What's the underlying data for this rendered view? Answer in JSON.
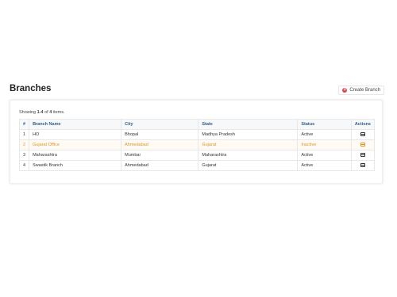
{
  "header": {
    "title": "Branches",
    "create_label": "Create Branch"
  },
  "summary": {
    "prefix": "Showing ",
    "range": "1-4",
    "of": " of ",
    "total": "4",
    "suffix": " items."
  },
  "table": {
    "columns": [
      "#",
      "Branch Name",
      "City",
      "State",
      "Status",
      "Actions"
    ],
    "rows": [
      {
        "num": "1",
        "name": "HO",
        "city": "Bhopal",
        "state": "Madhya Pradesh",
        "status": "Active"
      },
      {
        "num": "2",
        "name": "Gujarat Office",
        "city": "Ahmedabad",
        "state": "Gujarat",
        "status": "Inactive"
      },
      {
        "num": "3",
        "name": "Maharashtra",
        "city": "Mumbai",
        "state": "Maharashtra",
        "status": "Active"
      },
      {
        "num": "4",
        "name": "Swastik Branch",
        "city": "Ahmedabad",
        "state": "Gujarat",
        "status": "Active"
      }
    ]
  },
  "colors": {
    "header_text": "#355d8c",
    "inactive_row": "#e0962a",
    "create_icon": "#e04848"
  },
  "icons": {
    "create": "plus-circle-icon",
    "action": "view-icon"
  }
}
